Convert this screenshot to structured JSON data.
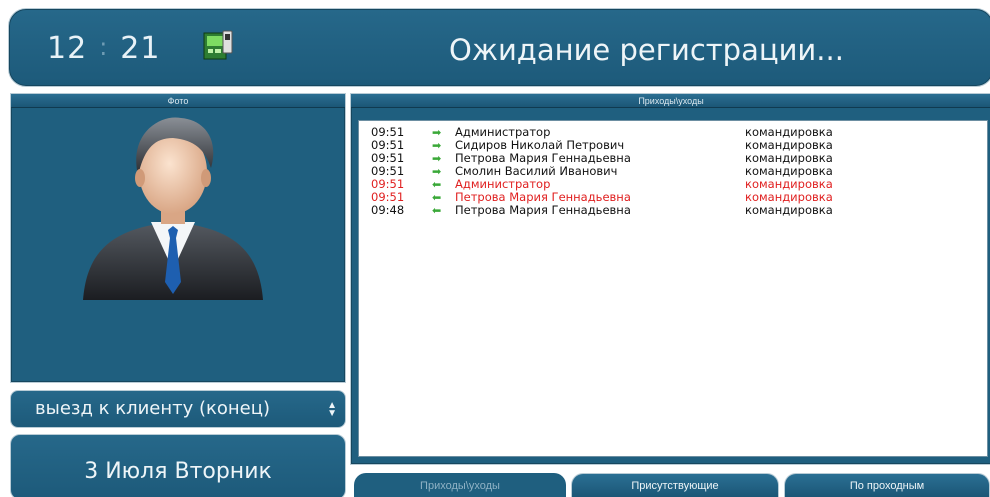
{
  "header": {
    "clock_hours": "12",
    "clock_separator": ":",
    "clock_minutes": "21",
    "status_icon": "card-reader-icon",
    "title": "Ожидание регистрации..."
  },
  "photo_panel": {
    "title": "Фото",
    "avatar_icon": "user-avatar-icon"
  },
  "event_select": {
    "selected_value": "выезд к клиенту (конец)"
  },
  "date": {
    "text": "3 Июля Вторник"
  },
  "log_panel": {
    "title": "Приходы\\уходы",
    "rows": [
      {
        "time": "09:51",
        "direction": "in",
        "name": "Администратор",
        "reason": "командировка",
        "alert": false
      },
      {
        "time": "09:51",
        "direction": "in",
        "name": "Сидиров Николай Петрович",
        "reason": "командировка",
        "alert": false
      },
      {
        "time": "09:51",
        "direction": "in",
        "name": "Петрова Мария Геннадьевна",
        "reason": "командировка",
        "alert": false
      },
      {
        "time": "09:51",
        "direction": "in",
        "name": "Смолин Василий Иванович",
        "reason": "командировка",
        "alert": false
      },
      {
        "time": "09:51",
        "direction": "out",
        "name": "Администратор",
        "reason": "командировка",
        "alert": true
      },
      {
        "time": "09:51",
        "direction": "out",
        "name": "Петрова Мария Геннадьевна",
        "reason": "командировка",
        "alert": true
      },
      {
        "time": "09:48",
        "direction": "out",
        "name": "Петрова Мария Геннадьевна",
        "reason": "командировка",
        "alert": false
      }
    ]
  },
  "tabs": [
    {
      "label": "Приходы\\уходы",
      "active": true
    },
    {
      "label": "Присутствующие",
      "active": false
    },
    {
      "label": "По проходным",
      "active": false
    }
  ],
  "colors": {
    "panel": "#1f5f7f",
    "arrow": "#3aa838",
    "alert": "#e02020"
  }
}
